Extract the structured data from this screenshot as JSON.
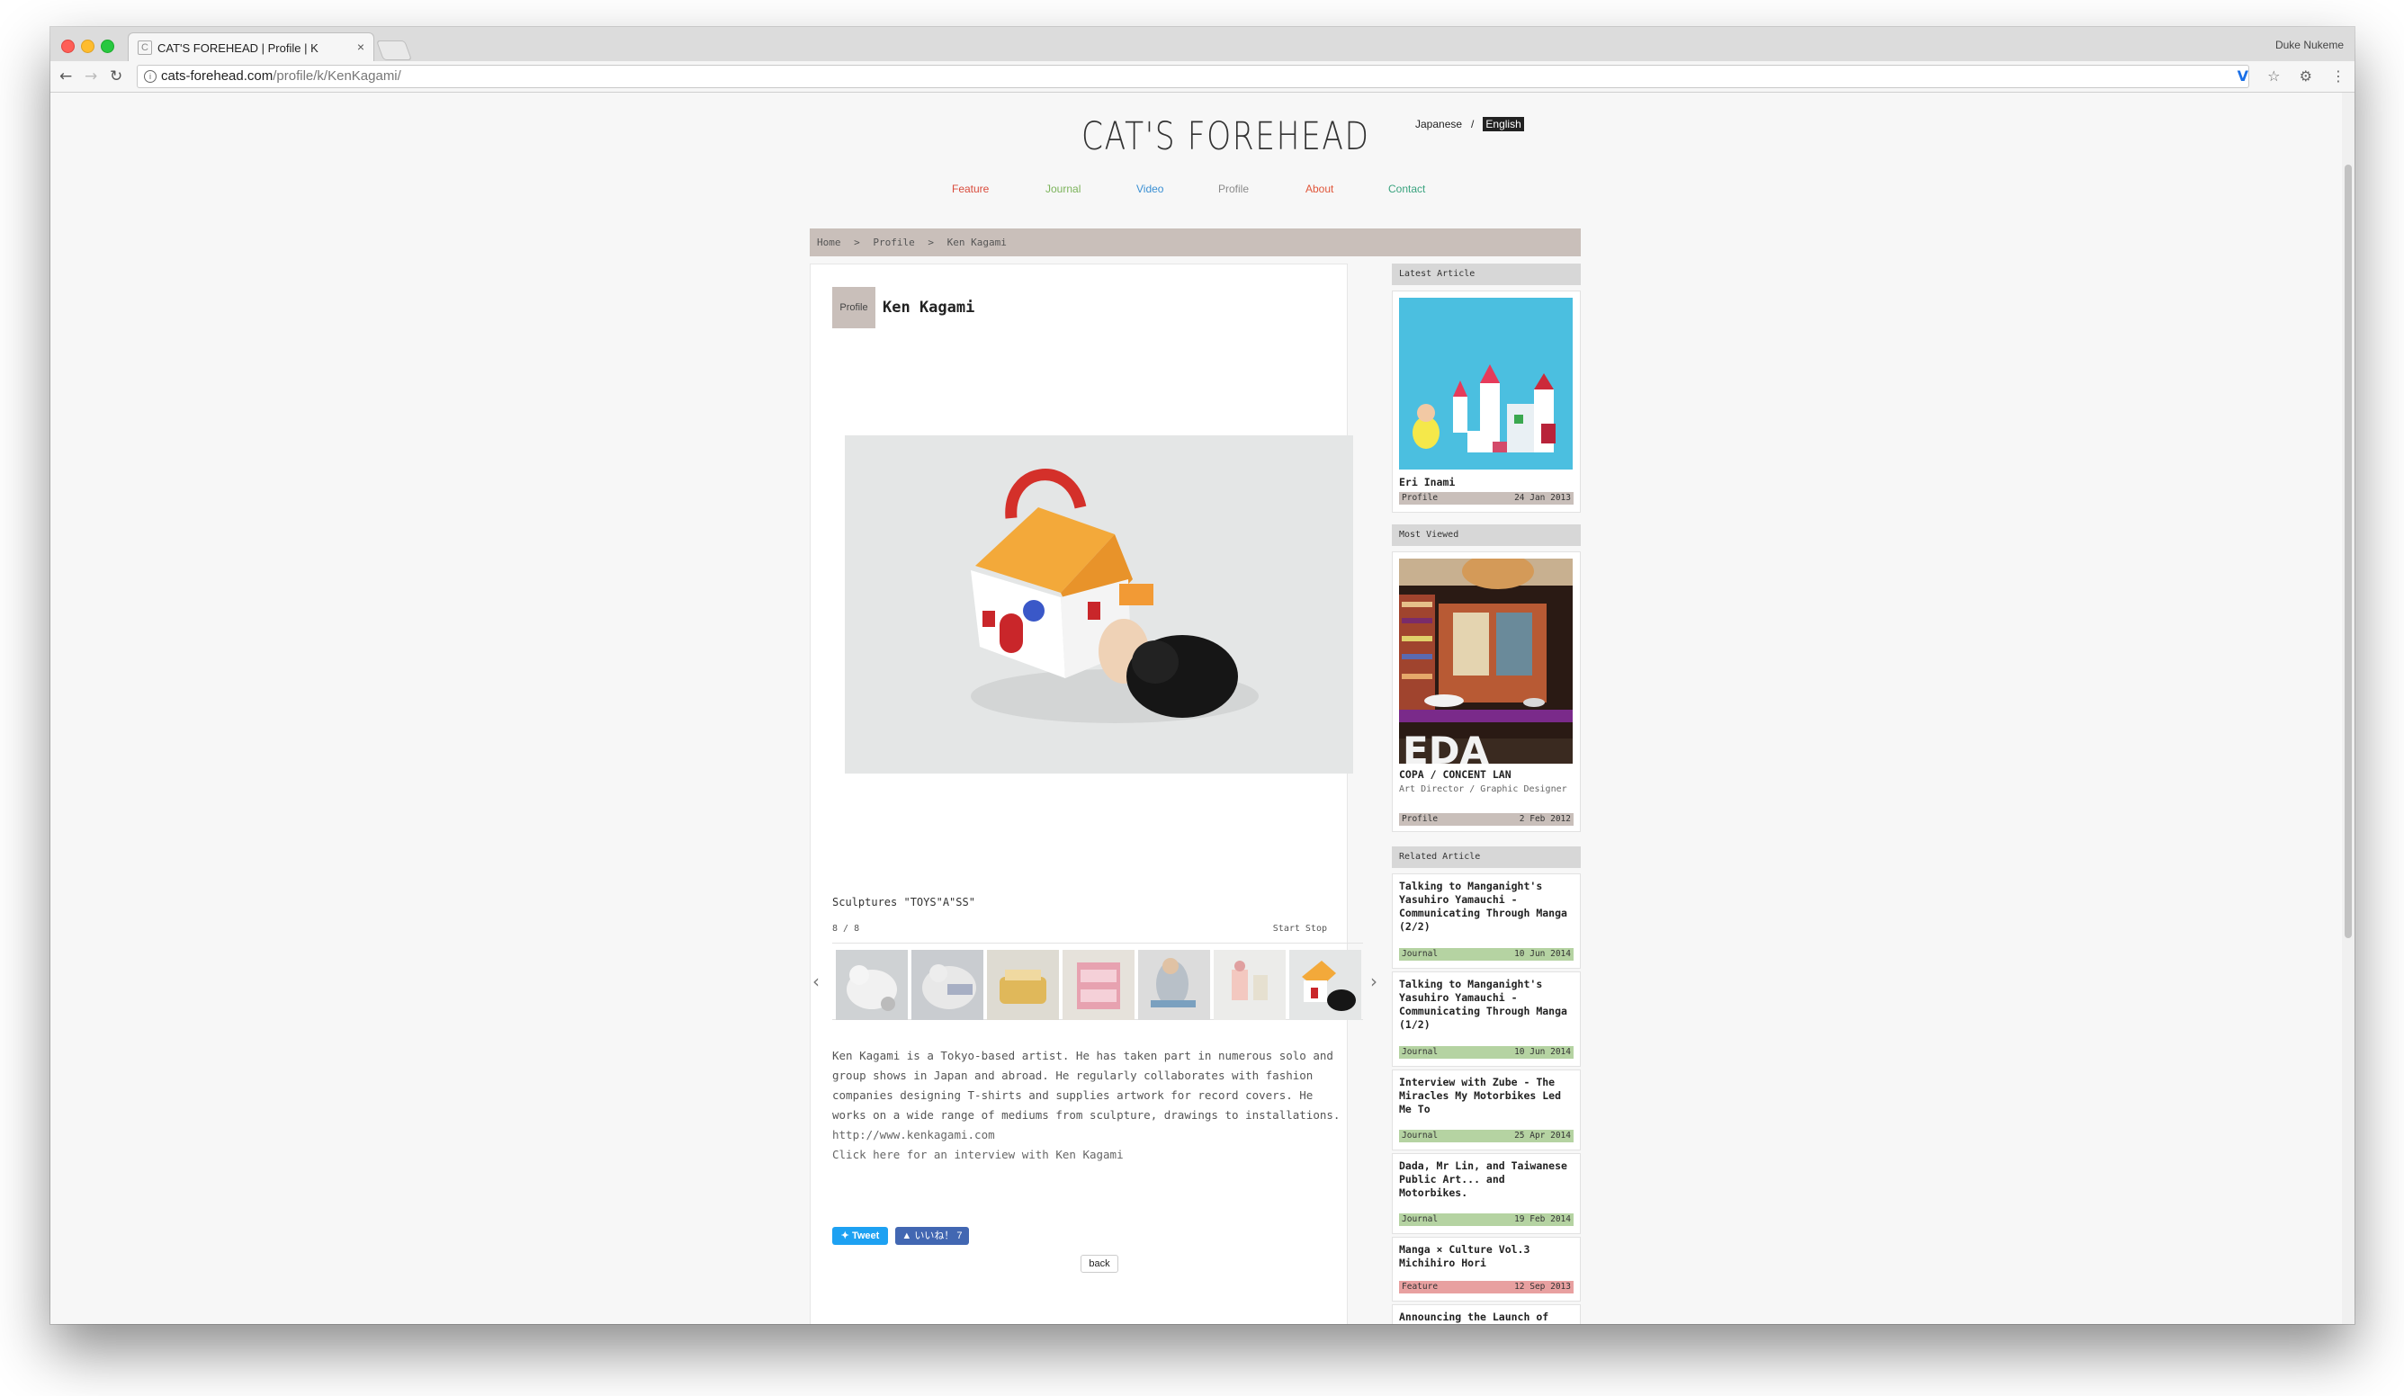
{
  "browser": {
    "tab_title": "CAT'S FOREHEAD | Profile | K",
    "tab_close": "×",
    "user_name": "Duke Nukeme",
    "url_host": "cats-forehead.com",
    "url_path": "/profile/k/KenKagami/"
  },
  "header": {
    "logo": "CAT'S FOREHEAD",
    "lang_japanese": "Japanese",
    "lang_sep": "/",
    "lang_english": "English"
  },
  "menu": {
    "items": [
      {
        "label": "Feature",
        "color": "#d94b3c"
      },
      {
        "label": "Journal",
        "color": "#7bb35a"
      },
      {
        "label": "Video",
        "color": "#3a8fd3"
      },
      {
        "label": "Profile",
        "color": "#8a8a8a"
      },
      {
        "label": "About",
        "color": "#e0563a"
      },
      {
        "label": "Contact",
        "color": "#3aa37f"
      }
    ]
  },
  "breadcrumb": {
    "home": "Home",
    "sep": ">",
    "profile": "Profile",
    "current": "Ken Kagami"
  },
  "article": {
    "badge": "Profile",
    "title": "Ken Kagami",
    "caption": "Sculptures \"TOYS\"A\"SS\"",
    "counter": "8 / 8",
    "slideshow_controls": "Start Stop",
    "bio": "Ken Kagami is a Tokyo-based artist. He has taken part in numerous solo and group shows in Japan and abroad. He regularly collaborates with fashion companies designing T-shirts and supplies artwork for record covers. He works on a wide range of mediums from sculpture, drawings to installations.",
    "link_site": "http://www.kenkagami.com",
    "link_interview": "Click here for an interview with Ken Kagami",
    "tweet_label": "Tweet",
    "like_label": "いいね！ 7",
    "back_label": "back"
  },
  "sidebar": {
    "latest_head": "Latest Article",
    "latest": {
      "title": "Eri Inami",
      "cat": "Profile",
      "date": "24 Jan 2013"
    },
    "most_head": "Most Viewed",
    "most": {
      "title": "COPA / CONCENT LAN",
      "sub": "Art Director / Graphic Designer",
      "cat": "Profile",
      "date": "2 Feb 2012"
    },
    "related_head": "Related Article",
    "related": [
      {
        "title": "Talking to Manganight's Yasuhiro Yamauchi - Communicating Through Manga (2/2)",
        "cat": "Journal",
        "date": "10 Jun 2014"
      },
      {
        "title": "Talking to Manganight's Yasuhiro Yamauchi - Communicating Through Manga (1/2)",
        "cat": "Journal",
        "date": "10 Jun 2014"
      },
      {
        "title": "Interview with Zube - The Miracles My Motorbikes Led Me To",
        "cat": "Journal",
        "date": "25 Apr 2014"
      },
      {
        "title": "Dada, Mr Lin, and Taiwanese Public Art... and Motorbikes.",
        "cat": "Journal",
        "date": "19 Feb 2014"
      },
      {
        "title": "Manga × Culture Vol.3 Michihiro Hori",
        "cat": "Feature",
        "date": "12 Sep 2013"
      },
      {
        "title": "Announcing the Launch of",
        "cat": "",
        "date": ""
      }
    ]
  },
  "colors": {
    "profile_bar": "#c9bfba",
    "journal_bar": "#b5d3a2",
    "feature_bar": "#e8a0a0"
  }
}
